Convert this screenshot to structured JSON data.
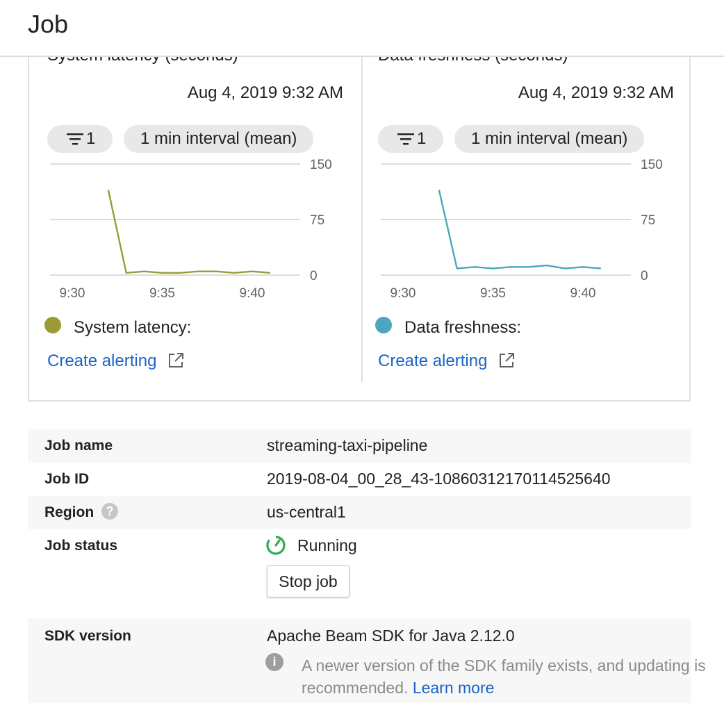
{
  "header": {
    "title": "Job"
  },
  "charts": [
    {
      "cut_title": "System latency (seconds)",
      "timestamp": "Aug 4, 2019 9:32 AM",
      "filter_count": "1",
      "interval": "1 min interval (mean)",
      "legend": "System latency:",
      "legend_color": "#9a9b37",
      "alert_label": "Create alerting"
    },
    {
      "cut_title": "Data freshness (seconds)",
      "timestamp": "Aug 4, 2019 9:32 AM",
      "filter_count": "1",
      "interval": "1 min interval (mean)",
      "legend": "Data freshness:",
      "legend_color": "#4aa7bd",
      "alert_label": "Create alerting"
    }
  ],
  "chart_data": [
    {
      "type": "line",
      "x": [
        "9:32",
        "9:33",
        "9:34",
        "9:35",
        "9:36",
        "9:37",
        "9:38",
        "9:39",
        "9:40",
        "9:41"
      ],
      "series": [
        {
          "name": "System latency",
          "values": [
            115,
            3,
            5,
            3,
            3,
            5,
            5,
            3,
            5,
            3
          ]
        }
      ],
      "xticks": [
        "9:30",
        "9:35",
        "9:40"
      ],
      "yticks": [
        "0",
        "75",
        "150"
      ],
      "ylim": [
        0,
        150
      ],
      "color": "#9a9b37"
    },
    {
      "type": "line",
      "x": [
        "9:32",
        "9:33",
        "9:34",
        "9:35",
        "9:36",
        "9:37",
        "9:38",
        "9:39",
        "9:40",
        "9:41"
      ],
      "series": [
        {
          "name": "Data freshness",
          "values": [
            115,
            9,
            11,
            9,
            11,
            11,
            13,
            9,
            11,
            9
          ]
        }
      ],
      "xticks": [
        "9:30",
        "9:35",
        "9:40"
      ],
      "yticks": [
        "0",
        "75",
        "150"
      ],
      "ylim": [
        0,
        150
      ],
      "color": "#4aa7bd"
    }
  ],
  "details": {
    "job_name_label": "Job name",
    "job_name": "streaming-taxi-pipeline",
    "job_id_label": "Job ID",
    "job_id": "2019-08-04_00_28_43-10860312170114525640",
    "region_label": "Region",
    "region": "us-central1",
    "status_label": "Job status",
    "status": "Running",
    "stop_button": "Stop job",
    "sdk_label": "SDK version",
    "sdk": "Apache Beam SDK for Java 2.12.0",
    "sdk_note": "A newer version of the SDK family exists, and updating is recommended.",
    "learn_more": "Learn more"
  },
  "help_glyph": "?",
  "info_glyph": "i",
  "accent_color": "#1a63c9"
}
